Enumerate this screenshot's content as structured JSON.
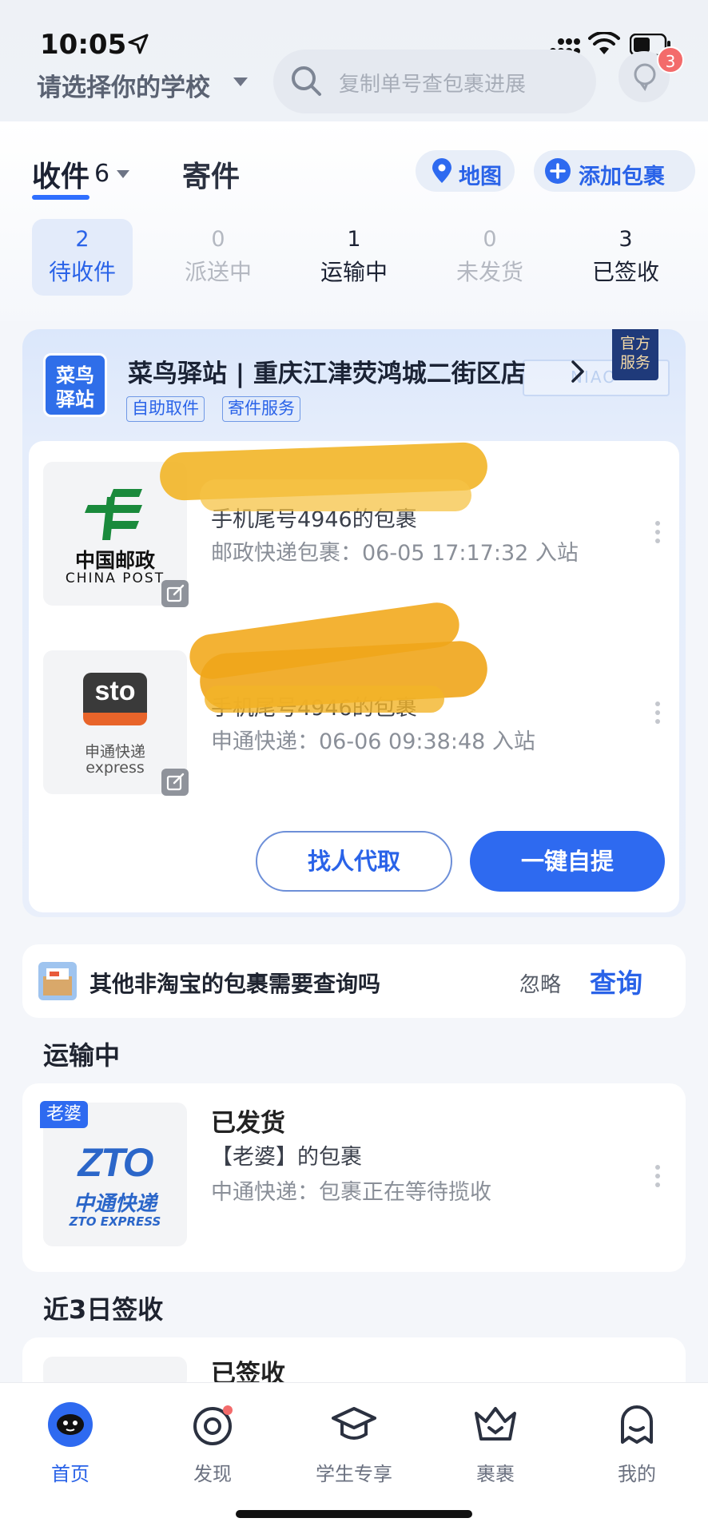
{
  "status_bar": {
    "time": "10:05"
  },
  "header": {
    "school_label": "请选择你的学校",
    "search_placeholder": "复制单号查包裹进展",
    "message_badge": "3"
  },
  "tabs": {
    "receive_label": "收件",
    "receive_count": "6",
    "send_label": "寄件",
    "map_label": "地图",
    "add_label": "添加包裹"
  },
  "stats": [
    {
      "count": "2",
      "label": "待收件"
    },
    {
      "count": "0",
      "label": "派送中"
    },
    {
      "count": "1",
      "label": "运输中"
    },
    {
      "count": "0",
      "label": "未发货"
    },
    {
      "count": "3",
      "label": "已签收"
    }
  ],
  "station": {
    "logo_text_1": "菜鸟",
    "logo_text_2": "驿站",
    "name": "菜鸟驿站 | 重庆江津荧鸿城二街区店",
    "tags": [
      "自助取件",
      "寄件服务"
    ],
    "official_1": "官方",
    "official_2": "服务",
    "deco_text": "NIAO",
    "packages": [
      {
        "brand_cn": "中国邮政",
        "brand_en": "CHINA POST",
        "subtitle": "手机尾号4946的包裹",
        "info": "邮政快递包裹：06-05 17:17:32 入站"
      },
      {
        "brand_cn": "申通快递",
        "brand_en": "express",
        "brand_mark": "sto",
        "subtitle": "手机尾号4946的包裹",
        "info": "申通快递：06-06 09:38:48 入站"
      }
    ],
    "proxy_button": "找人代取",
    "self_button": "一键自提"
  },
  "query_card": {
    "text": "其他非淘宝的包裹需要查询吗",
    "ignore": "忽略",
    "query": "查询"
  },
  "in_transit": {
    "section_title": "运输中",
    "nick_tag": "老婆",
    "title": "已发货",
    "subtitle": "【老婆】的包裹",
    "info": "中通快递：包裹正在等待揽收",
    "brand_cn": "中通快递",
    "brand_en": "ZTO EXPRESS",
    "brand_mark": "ZTO"
  },
  "signed": {
    "section_title": "近3日签收",
    "title": "已签收"
  },
  "bottom_nav": [
    {
      "label": "首页"
    },
    {
      "label": "发现"
    },
    {
      "label": "学生专享"
    },
    {
      "label": "裹裹"
    },
    {
      "label": "我的"
    }
  ],
  "colors": {
    "accent": "#2e6af0",
    "badge": "#f36b6b",
    "scribble": "#f2b527"
  }
}
